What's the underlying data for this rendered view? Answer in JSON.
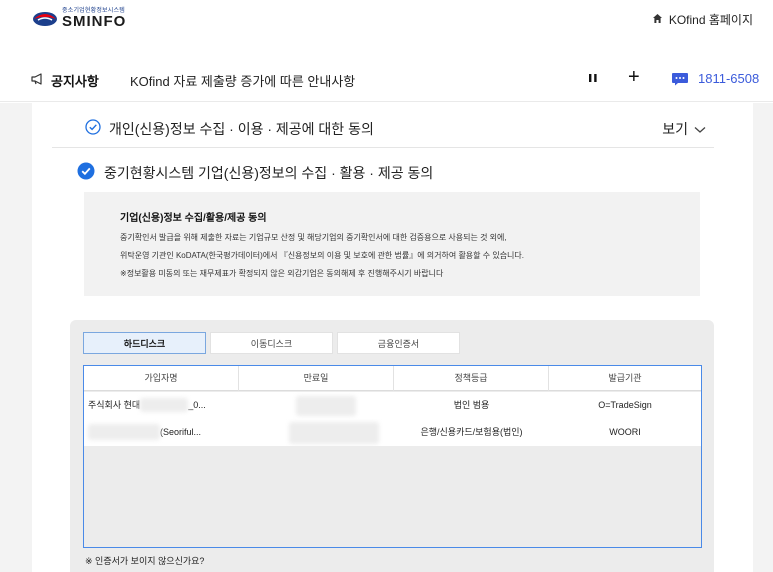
{
  "header": {
    "logo_sub": "중소기업현황정보시스템",
    "logo_main": "SMINFO",
    "home_link": "KOfind 홈페이지"
  },
  "notice": {
    "label": "공지사항",
    "text": "KOfind 자료 제출량 증가에 따른 안내사항",
    "phone": "1811-6508"
  },
  "consents": {
    "item1": {
      "label": "개인(신용)정보 수집 · 이용 · 제공에 대한 동의",
      "view": "보기"
    },
    "item2": {
      "label": "중기현황시스템 기업(신용)정보의 수집 · 활용 · 제공 동의"
    }
  },
  "info": {
    "title": "기업(신용)정보 수집/활용/제공 동의",
    "lines": [
      "중기확인서 발급을 위해 제출한 자료는 기업규모 산정 및 해당기업의 중기확인서에 대한 검증용으로 사용되는 것 외에,",
      "위탁운영 기관인 KoDATA(한국평가데이터)에서 『신용정보의 이용 및 보호에 관한 법률』에 의거하여 활용할 수 있습니다.",
      "※정보활용 미동의 또는 재무제표가 확정되지 않은 외감기업은 동의해제 후 진행해주시기 바랍니다"
    ]
  },
  "cert": {
    "tabs": [
      "하드디스크",
      "이동디스크",
      "금융인증서"
    ],
    "active_tab": 0,
    "columns": [
      "가입자명",
      "만료일",
      "정책등급",
      "발급기관"
    ],
    "rows": [
      {
        "name_prefix": "주식회사 현대",
        "name_suffix": "_0...",
        "expiry": "",
        "policy": "법인 범용",
        "issuer": "O=TradeSign"
      },
      {
        "name_prefix": "",
        "name_suffix": "(Seoriful...",
        "expiry": "",
        "policy": "은행/신용카드/보험용(법인)",
        "issuer": "WOORI"
      }
    ],
    "help": "※ 인증서가 보이지 않으신가요?"
  },
  "colors": {
    "accent": "#1e6fe0",
    "phone": "#3b5bdb",
    "table_border": "#4a8ae8"
  }
}
